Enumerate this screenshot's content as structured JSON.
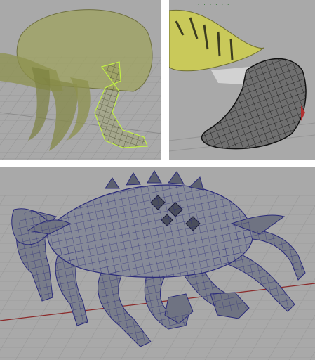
{
  "viewports": [
    {
      "id": "vp-a",
      "subject": "crab-claw-xray-wireframe",
      "caption": ""
    },
    {
      "id": "vp-b",
      "subject": "crab-claw-polygon-mesh",
      "caption": ""
    },
    {
      "id": "vp-c",
      "subject": "crab-full-body-mesh",
      "caption": ""
    }
  ],
  "colors": {
    "viewport_bg": "#a9a9a9",
    "grid_line": "#8f8f8f",
    "axis_red": "#8b2a2a",
    "shell_olive": "#9ea25a",
    "mesh_grey": "#787c8a",
    "wire_blue": "#2a2a7a",
    "wire_green": "#c8ff40",
    "spikes_yellow": "#c9c95a",
    "wire_black": "#111111"
  }
}
